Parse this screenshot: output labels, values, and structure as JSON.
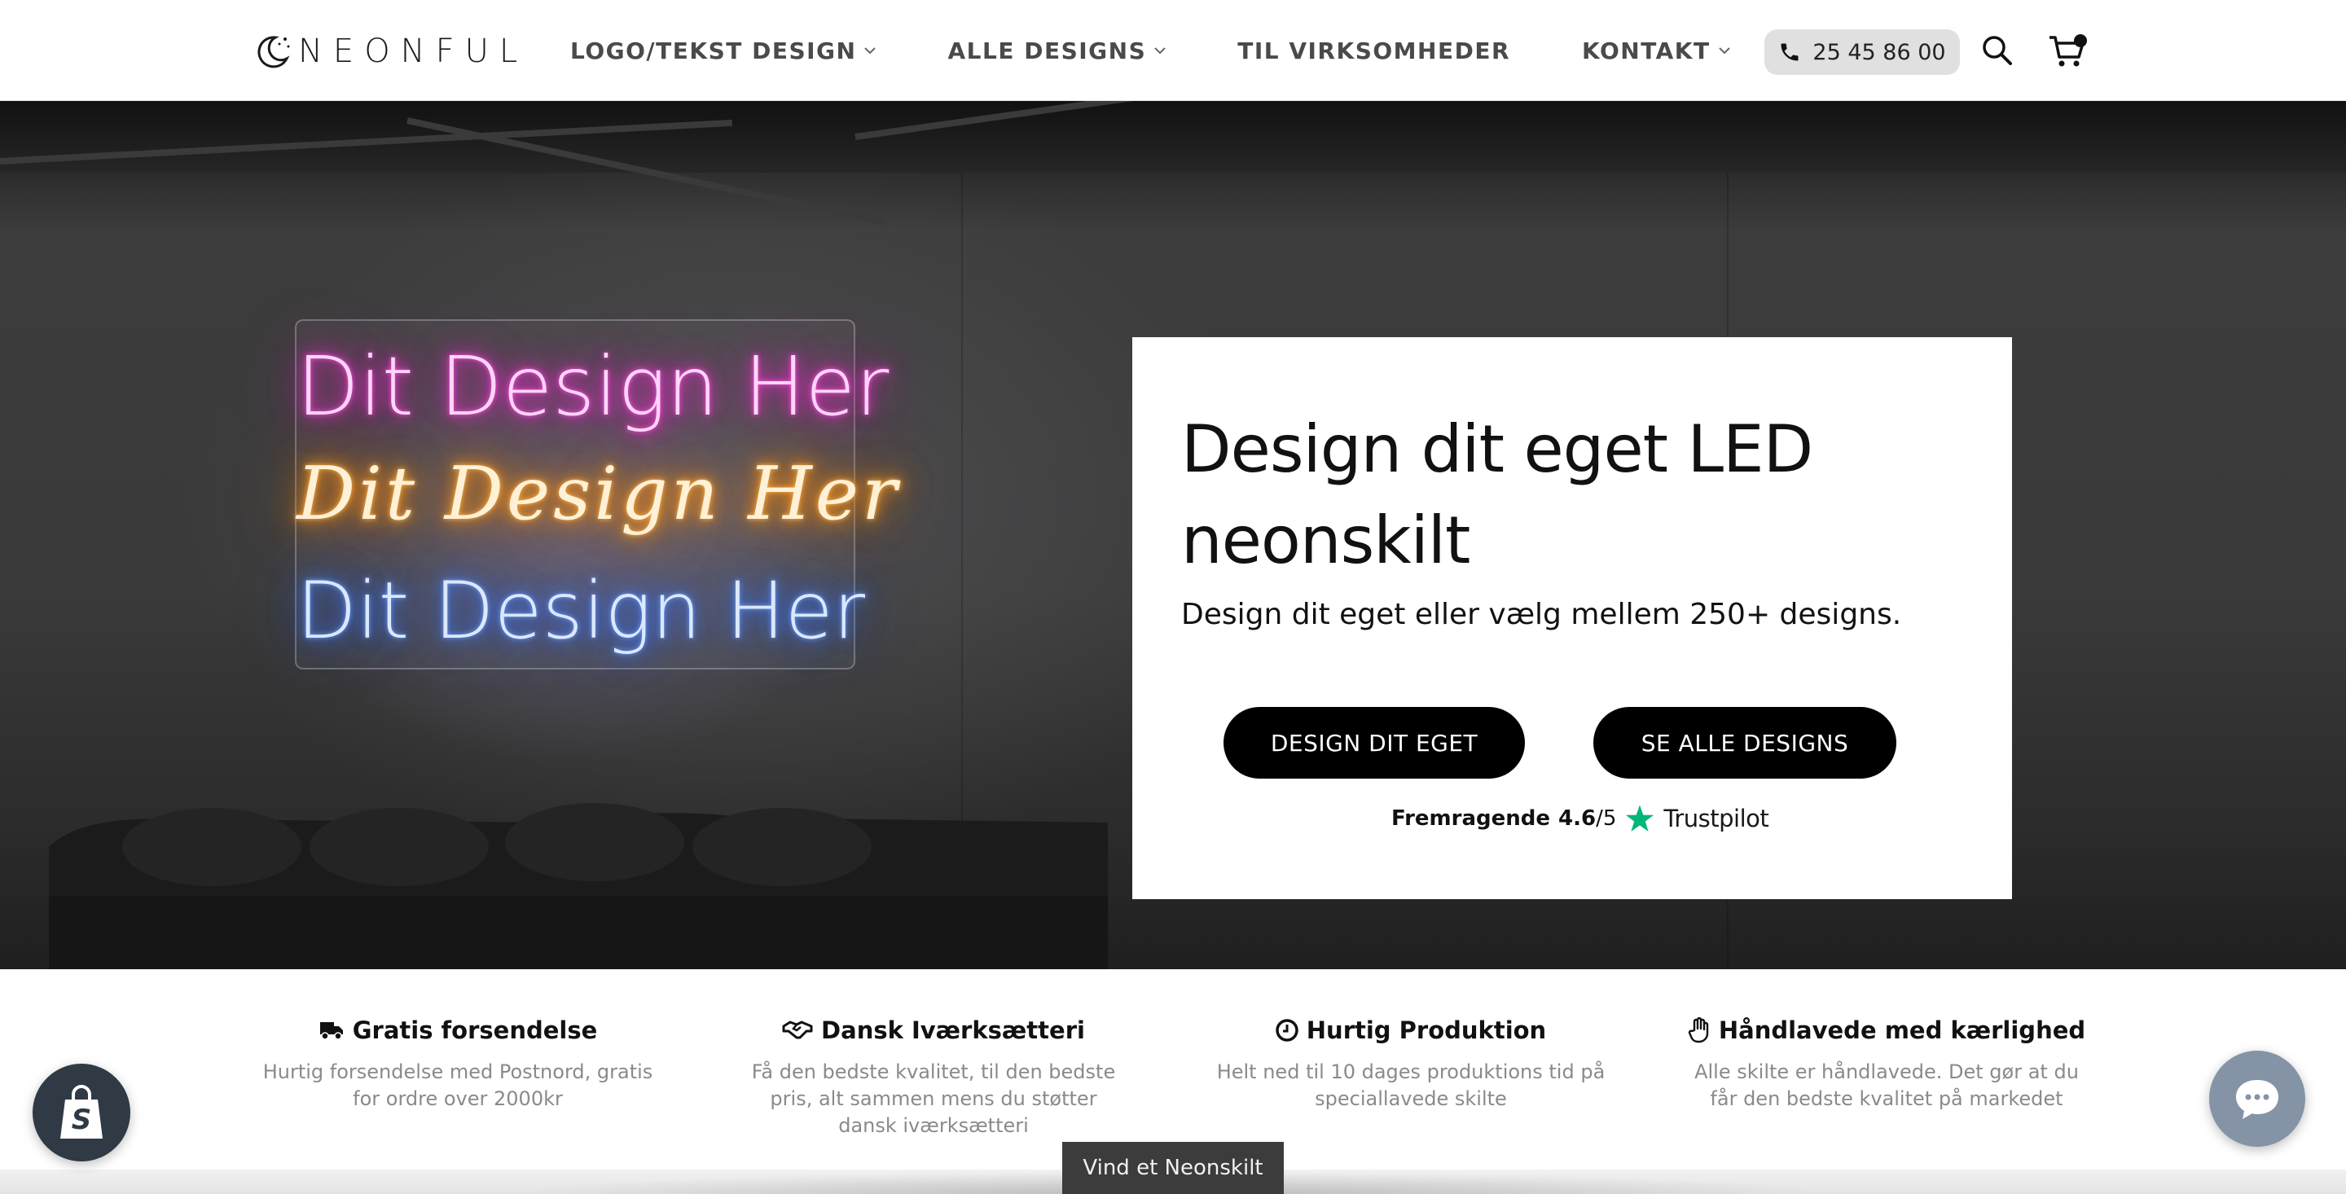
{
  "brand": {
    "name": "NEONFUL",
    "logo_icon": "moon-stars-icon"
  },
  "nav": {
    "items": [
      {
        "label": "LOGO/TEKST DESIGN",
        "has_dropdown": true
      },
      {
        "label": "ALLE DESIGNS",
        "has_dropdown": true
      },
      {
        "label": "TIL VIRKSOMHEDER",
        "has_dropdown": false
      },
      {
        "label": "KONTAKT",
        "has_dropdown": true
      }
    ],
    "phone": "25 45 86 00",
    "icons": [
      "phone-icon",
      "search-icon",
      "cart-icon"
    ]
  },
  "hero": {
    "neon_lines": [
      "Dit Design Her",
      "Dit Design Her",
      "Dit Design Her"
    ],
    "neon_colors": [
      "#ff2ad4",
      "#ff9a1f",
      "#3f7bff"
    ],
    "title": "Design dit eget LED neonskilt",
    "subtitle": "Design dit eget eller vælg mellem 250+ designs.",
    "buttons": {
      "design": "DESIGN DIT EGET",
      "all": "SE ALLE DESIGNS"
    },
    "rating": {
      "label": "Fremragende",
      "score": "4.6",
      "scale": "/5",
      "provider": "Trustpilot",
      "star_color": "#00b67a"
    }
  },
  "features": [
    {
      "icon": "truck-icon",
      "title": "Gratis forsendelse",
      "desc": "Hurtig forsendelse med Postnord, gratis for ordre over 2000kr"
    },
    {
      "icon": "handshake-icon",
      "title": "Dansk Iværksætteri",
      "desc": "Få den bedste kvalitet, til den bedste pris, alt sammen mens du støtter dansk iværksætteri"
    },
    {
      "icon": "clock-icon",
      "title": "Hurtig Produktion",
      "desc": "Helt ned til 10 dages produktions tid på speciallavede skilte"
    },
    {
      "icon": "hand-icon",
      "title": "Håndlavede med kærlighed",
      "desc": "Alle skilte er håndlavede. Det gør at du får den bedste kvalitet på markedet"
    }
  ],
  "widgets": {
    "finder_tab": "Vind et Neonskilt",
    "shopify_icon": "shopify-bag-icon",
    "chat_icon": "chat-bubble-icon",
    "chat_color": "#8494a6"
  }
}
